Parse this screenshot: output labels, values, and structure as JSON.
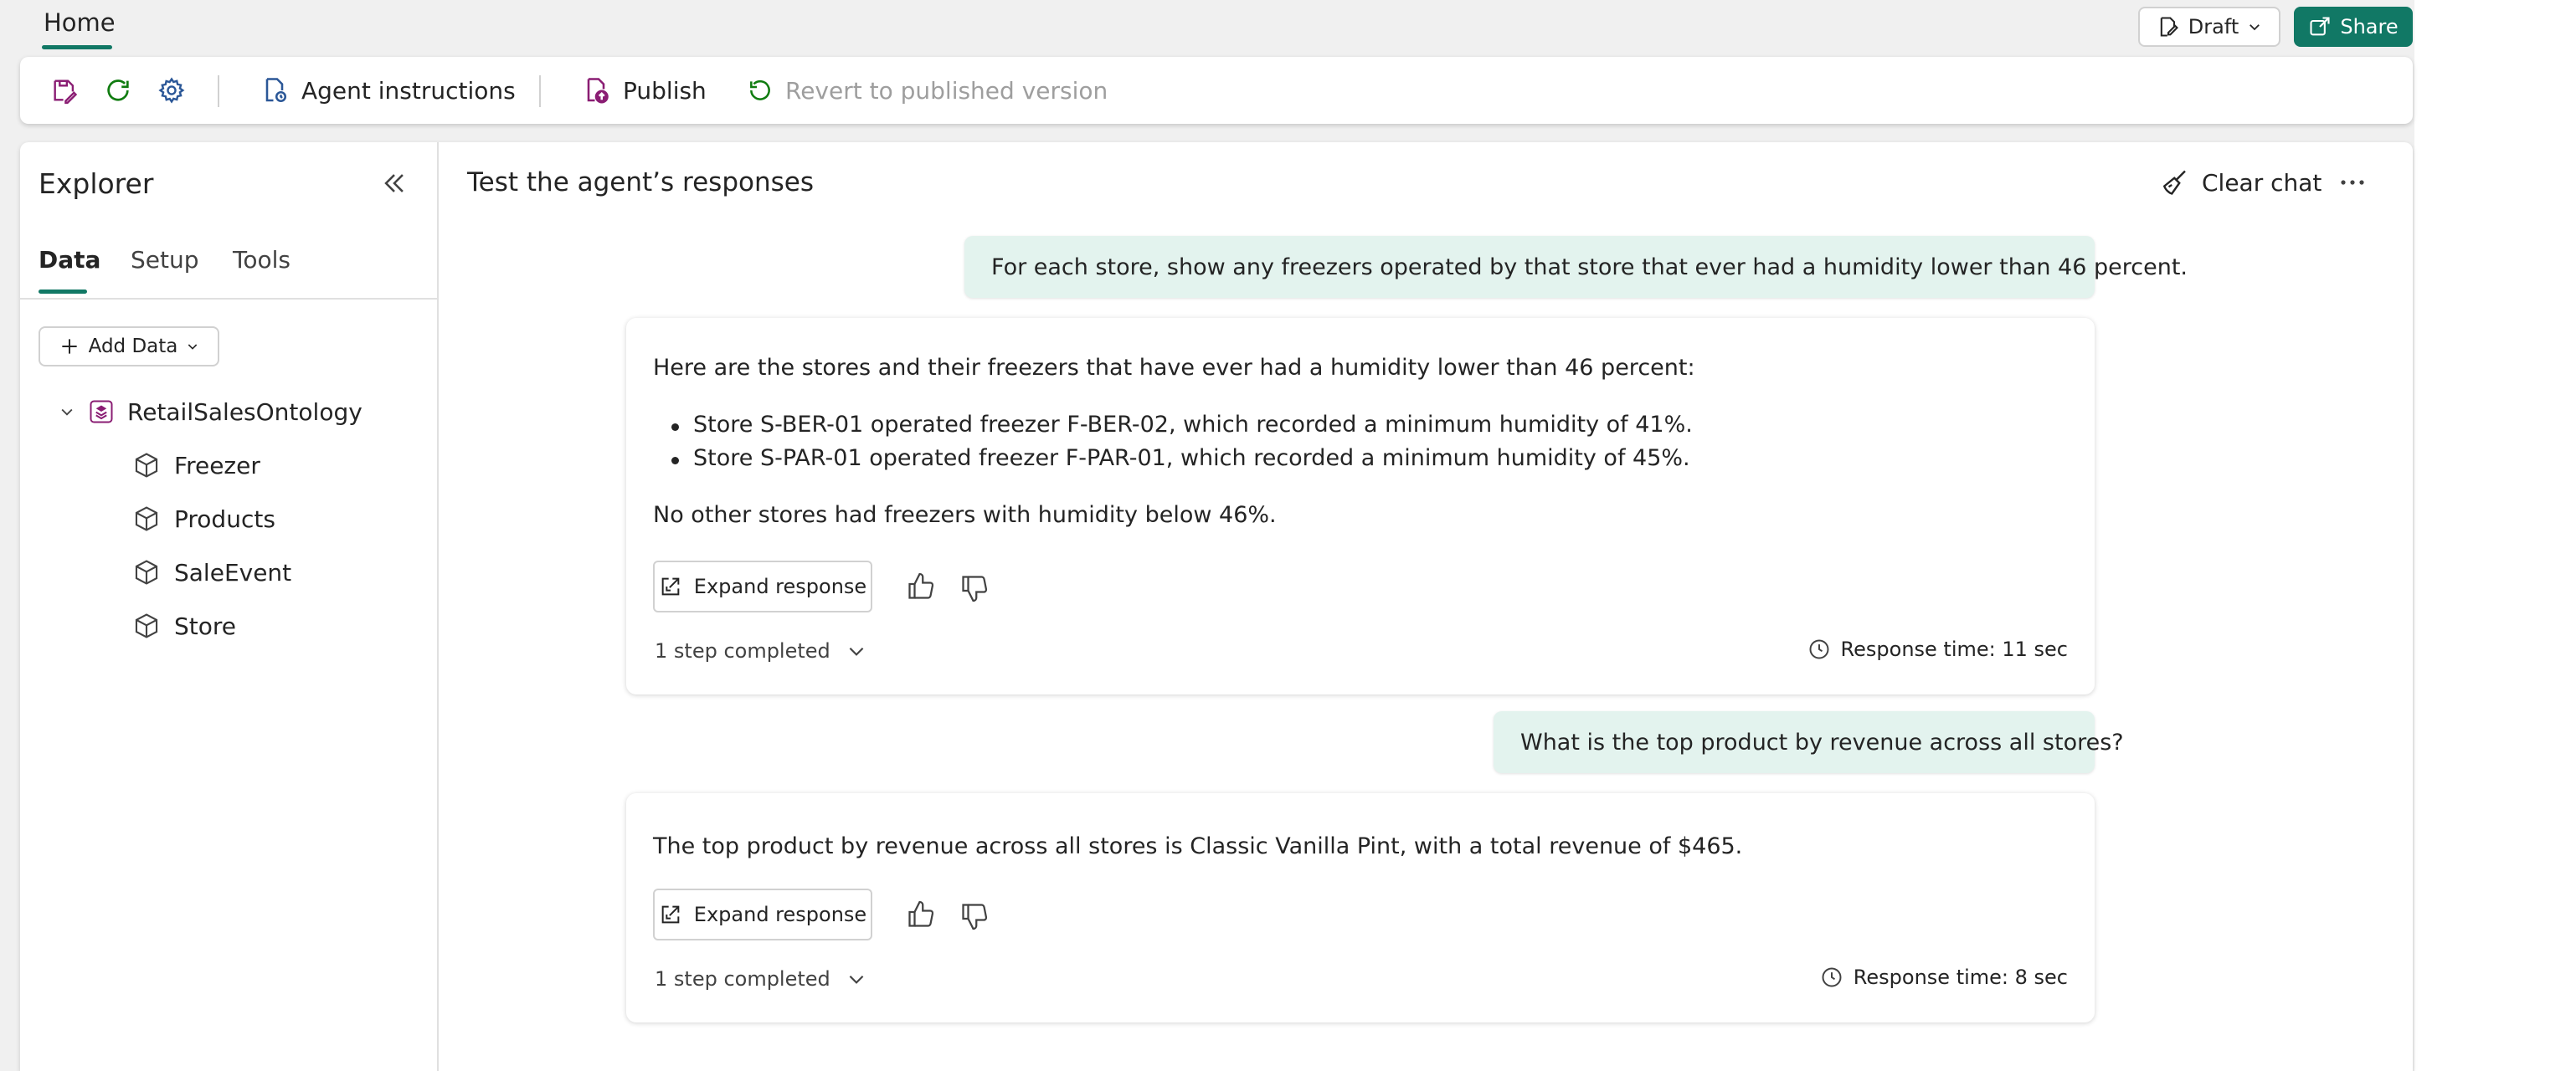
{
  "top_tabs": {
    "home": "Home"
  },
  "header": {
    "draft_label": "Draft",
    "share_label": "Share"
  },
  "toolbar": {
    "agent_instructions": "Agent instructions",
    "publish": "Publish",
    "revert": "Revert to published version"
  },
  "explorer": {
    "title": "Explorer",
    "tabs": [
      "Data",
      "Setup",
      "Tools"
    ],
    "add_data": "Add Data",
    "tree": {
      "root": "RetailSalesOntology",
      "items": [
        "Freezer",
        "Products",
        "SaleEvent",
        "Store"
      ]
    }
  },
  "chat": {
    "title": "Test the agent’s responses",
    "clear_chat": "Clear chat",
    "messages": [
      {
        "user": "For each store, show any freezers operated by that store that ever had a humidity lower than 46 percent.",
        "intro": "Here are the stores and their freezers that have ever had a humidity lower than 46 percent:",
        "bullets": [
          "Store S-BER-01 operated freezer F-BER-02, which recorded a minimum humidity of 41%.",
          "Store S-PAR-01 operated freezer F-PAR-01, which recorded a minimum humidity of 45%."
        ],
        "outro": "No other stores had freezers with humidity below 46%.",
        "expand": "Expand response",
        "steps": "1 step completed",
        "response_time": "Response time: 11 sec"
      },
      {
        "user": "What is the top product by revenue across all stores?",
        "intro": "The top product by revenue across all stores is Classic Vanilla Pint, with a total revenue of $465.",
        "expand": "Expand response",
        "steps": "1 step completed",
        "response_time": "Response time: 8 sec"
      }
    ]
  },
  "colors": {
    "accent": "#117865",
    "user_bubble": "#e3f3ee",
    "toolbar_icon": "#8a1d73"
  }
}
